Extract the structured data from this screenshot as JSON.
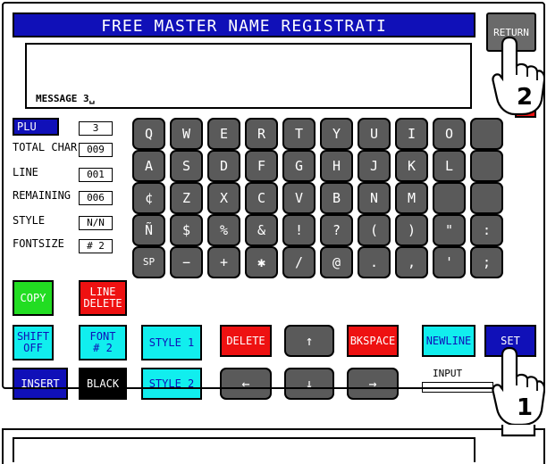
{
  "title": "FREE MASTER NAME REGISTRATI",
  "return_label": "RETURN",
  "message_text": "MESSAGE 3␣",
  "info": {
    "plu_label": "PLU No.",
    "plu_value": "3",
    "fields": [
      {
        "label": "TOTAL CHAR",
        "value": "009"
      },
      {
        "label": "LINE",
        "value": "001"
      },
      {
        "label": "REMAINING",
        "value": "006"
      },
      {
        "label": "STYLE",
        "value": "N/N"
      },
      {
        "label": "FONTSIZE",
        "value": "# 2"
      }
    ]
  },
  "keys": {
    "row1": [
      "Q",
      "W",
      "E",
      "R",
      "T",
      "Y",
      "U",
      "I",
      "O",
      ""
    ],
    "row2": [
      "A",
      "S",
      "D",
      "F",
      "G",
      "H",
      "J",
      "K",
      "L",
      ""
    ],
    "row3": [
      "¢",
      "Z",
      "X",
      "C",
      "V",
      "B",
      "N",
      "M",
      "",
      ""
    ],
    "row4": [
      "Ñ",
      "$",
      "%",
      "&",
      "!",
      "?",
      "(",
      ")",
      "\"",
      ":"
    ],
    "row5": [
      "SP",
      "−",
      "+",
      "✱",
      "/",
      "@",
      ".",
      ",",
      "'",
      ";"
    ]
  },
  "buttons": {
    "copy": "COPY",
    "line_delete": "LINE\nDELETE",
    "shift_off": "SHIFT\nOFF",
    "font": "FONT\n# 2",
    "style1": "STYLE 1",
    "style2": "STYLE 2",
    "delete": "DELETE",
    "bkspace": "BKSPACE",
    "newline": "NEWLINE",
    "set": "SET",
    "insert": "INSERT",
    "black": "BLACK",
    "up": "↑",
    "down": "↓",
    "left": "←",
    "right": "→"
  },
  "input_label": "INPUT",
  "callouts": [
    "1",
    "2"
  ],
  "colors": {
    "blue": "#1010b8",
    "green": "#22dd22",
    "red": "#ee1111",
    "cyan": "#11eeee",
    "dark": "#5a5a5a"
  }
}
